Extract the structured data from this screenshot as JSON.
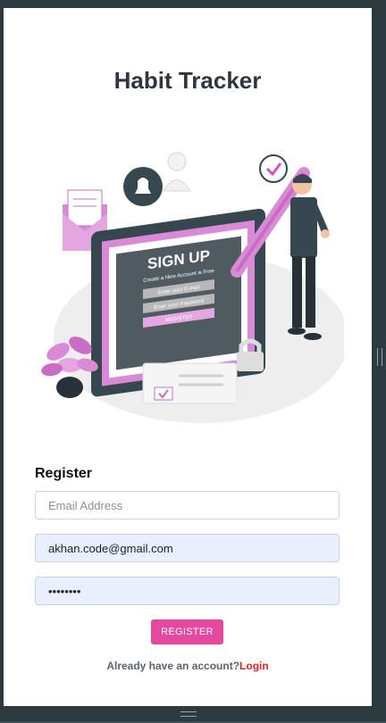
{
  "app": {
    "title": "Habit Tracker"
  },
  "illustration": {
    "heading": "SIGN UP",
    "subheading": "Create a New Account is Free",
    "email_placeholder": "Enter your E-mail",
    "password_placeholder": "Enter your Password",
    "button": "REGISTER"
  },
  "form": {
    "title": "Register",
    "email_placeholder": "Email Address",
    "username_value": "akhan.code@gmail.com",
    "password_value": "••••••••",
    "submit_label": "REGISTER"
  },
  "footer": {
    "prompt": "Already have an account?",
    "login_label": "Login"
  },
  "colors": {
    "accent": "#e4499f",
    "link": "#d62828",
    "filled_field": "#e8f0fd"
  }
}
